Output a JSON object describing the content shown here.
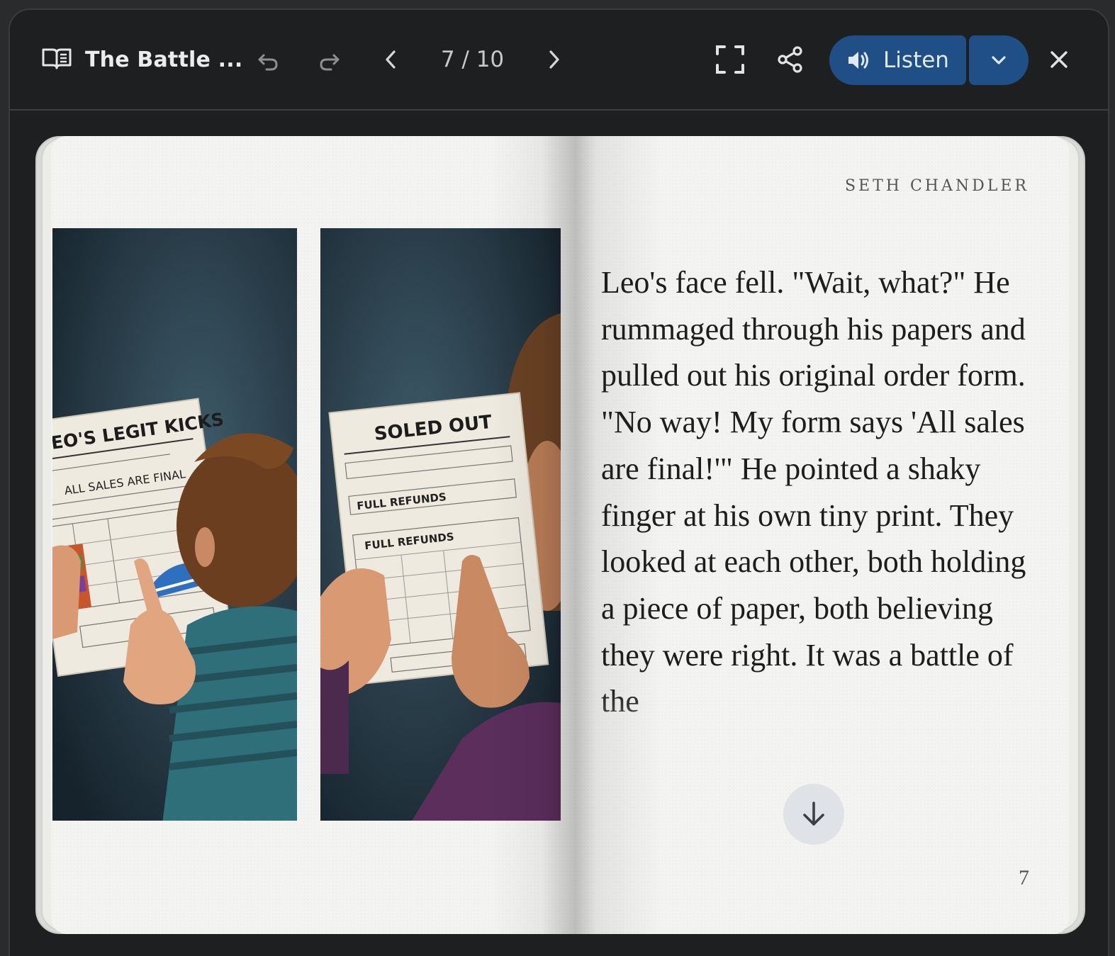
{
  "toolbar": {
    "title": "The Battle ...",
    "page_indicator": "7 / 10",
    "listen_label": "Listen",
    "icons": {
      "book": "book-open-icon",
      "undo": "undo-icon",
      "redo": "redo-icon",
      "prev": "chevron-left-icon",
      "next": "chevron-right-icon",
      "fullscreen": "fullscreen-icon",
      "share": "share-icon",
      "speaker": "speaker-icon",
      "dropdown": "chevron-down-icon",
      "close": "close-icon"
    }
  },
  "page": {
    "author": "SETH CHANDLER",
    "text": "Leo's face fell. \"Wait, what?\" He rummaged through his papers and pulled out his original order form. \"No way! My form says 'All sales are final!'\" He pointed a shaky finger at his own tiny print. They looked at each other, both holding a piece of paper, both believing they were right. It was a battle of the",
    "page_number": "7"
  },
  "illustration": {
    "left_panel": {
      "heading": "LEO'S LEGIT KICKS",
      "line": "ALL SALES ARE FINAL"
    },
    "right_panel": {
      "heading": "SOLED OUT",
      "line1": "FULL REFUNDS",
      "line2": "FULL REFUNDS"
    }
  },
  "colors": {
    "accent": "#1f4f86",
    "background": "#1e1f20",
    "paper": "#f3f3f1"
  }
}
